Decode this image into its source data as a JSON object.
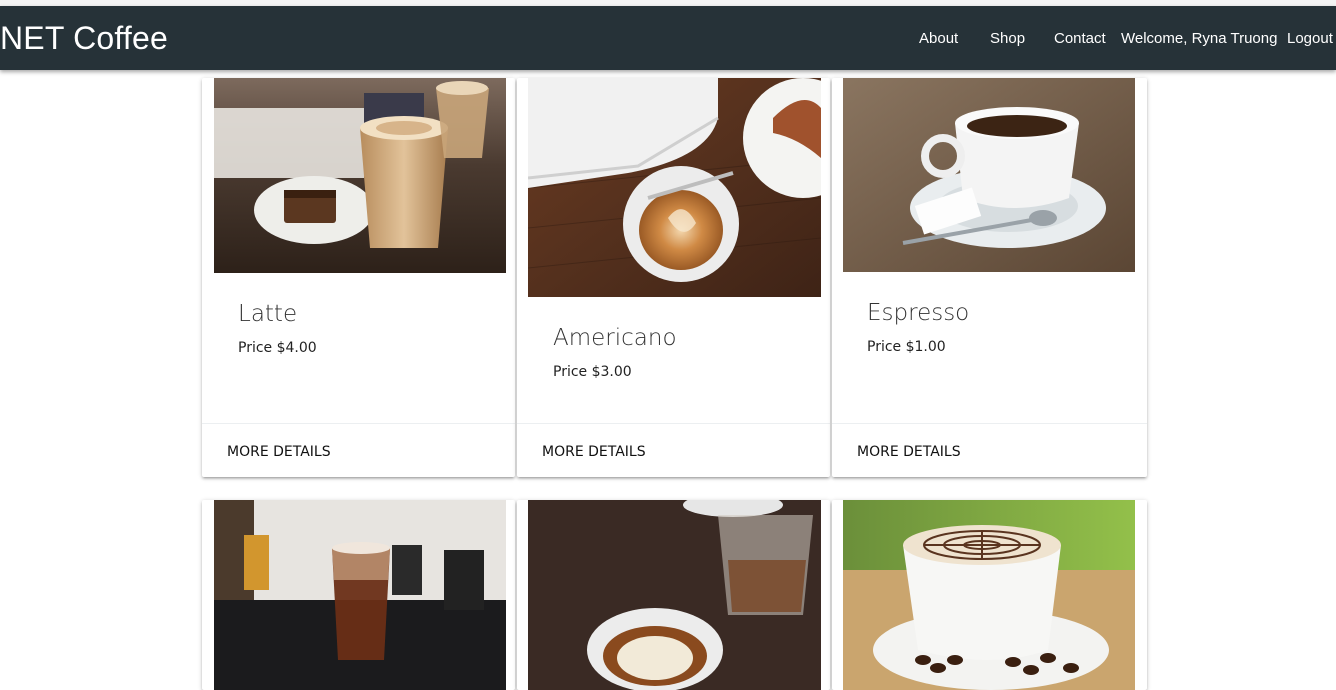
{
  "navbar": {
    "brand": "NET Coffee",
    "links": {
      "about": "About",
      "shop": "Shop",
      "contact": "Contact"
    },
    "welcome": "Welcome, Ryna Truong",
    "logout": "Logout",
    "background": "#263238"
  },
  "products": [
    {
      "name": "Latte",
      "price": "Price $4.00",
      "action": "MORE DETAILS"
    },
    {
      "name": "Americano",
      "price": "Price $3.00",
      "action": "MORE DETAILS"
    },
    {
      "name": "Espresso",
      "price": "Price $1.00",
      "action": "MORE DETAILS"
    },
    {
      "name": "",
      "price": "",
      "action": ""
    },
    {
      "name": "",
      "price": "",
      "action": ""
    },
    {
      "name": "",
      "price": "",
      "action": ""
    }
  ]
}
